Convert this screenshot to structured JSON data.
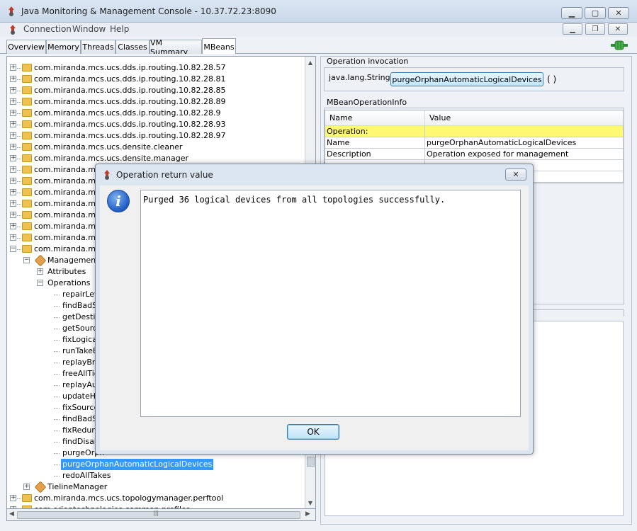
{
  "window": {
    "title": "Java Monitoring & Management Console - 10.37.72.23:8090",
    "minimize": "▁",
    "maximize": "▢",
    "close": "✕"
  },
  "menubar": {
    "items": [
      "Connection",
      "Window",
      "Help"
    ],
    "inner_minimize": "▁",
    "inner_restore": "❐",
    "inner_close": "✕"
  },
  "tabs": [
    "Overview",
    "Memory",
    "Threads",
    "Classes",
    "VM Summary",
    "MBeans"
  ],
  "tree": {
    "packages": [
      "com.miranda.mcs.ucs.dds.ip.routing.10.82.28.57",
      "com.miranda.mcs.ucs.dds.ip.routing.10.82.28.81",
      "com.miranda.mcs.ucs.dds.ip.routing.10.82.28.85",
      "com.miranda.mcs.ucs.dds.ip.routing.10.82.28.89",
      "com.miranda.mcs.ucs.dds.ip.routing.10.82.28.9",
      "com.miranda.mcs.ucs.dds.ip.routing.10.82.28.93",
      "com.miranda.mcs.ucs.dds.ip.routing.10.82.28.97",
      "com.miranda.mcs.ucs.densite.cleaner",
      "com.miranda.mcs.ucs.densite.manager",
      "com.miranda.mcs",
      "com.miranda.mcs",
      "com.miranda.mcs",
      "com.miranda.mcs",
      "com.miranda.mcs",
      "com.miranda.mcs",
      "com.miranda.mcs",
      "com.miranda.mcs"
    ],
    "management_label": "Management",
    "attributes_label": "Attributes",
    "operations_label": "Operations",
    "operations": [
      "repairLeve",
      "findBadSo",
      "getDestin",
      "getSource",
      "fixLogicall",
      "runTakeBy",
      "replayBnc",
      "freeAllTie",
      "replayAud",
      "updateHy",
      "fixSources",
      "findBadSt",
      "fixRedund",
      "findDisabl",
      "purgeOrph",
      "purgeOrphanAutomaticLogicalDevices",
      "redoAllTakes"
    ],
    "tieline_label": "TielineManager",
    "tail_packages": [
      "com.miranda.mcs.ucs.topologymanager.perftool",
      "com.orientechnologies.common.profiler"
    ]
  },
  "invocation": {
    "group_title": "Operation invocation",
    "return_type": "java.lang.String",
    "button_label": "purgeOrphanAutomaticLogicalDevices",
    "parens": "( )"
  },
  "info": {
    "group_title": "MBeanOperationInfo",
    "headers": [
      "Name",
      "Value"
    ],
    "rows": [
      [
        "Operation:",
        ""
      ],
      [
        "Name",
        "purgeOrphanAutomaticLogicalDevices"
      ],
      [
        "Description",
        "Operation exposed for management"
      ],
      [
        "",
        ""
      ],
      [
        "",
        ""
      ]
    ]
  },
  "dialog": {
    "title": "Operation return value",
    "message": "Purged 36 logical devices from all topologies successfully.",
    "ok_label": "OK"
  }
}
